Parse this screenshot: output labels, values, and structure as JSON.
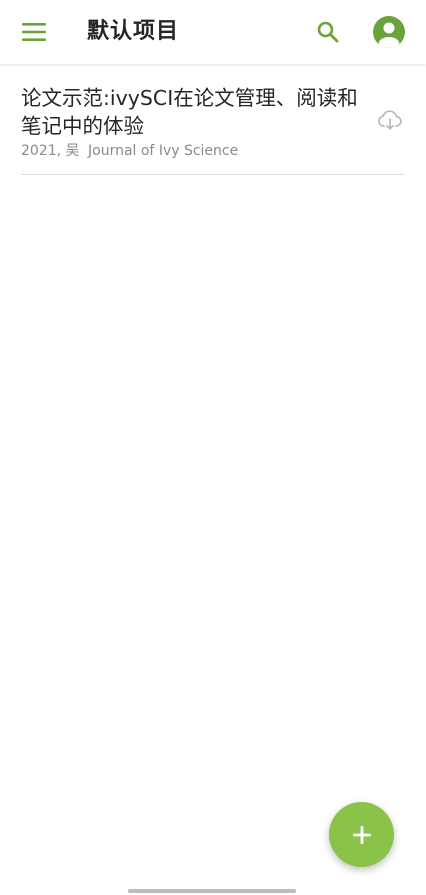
{
  "header": {
    "title": "默认项目",
    "icons": {
      "menu": "menu-icon",
      "search": "search-icon",
      "account": "account-circle-icon"
    }
  },
  "papers": [
    {
      "title": "论文示范:ivySCI在论文管理、阅读和笔记中的体验",
      "year": "2021,",
      "author": "吴",
      "journal": "Journal of Ivy Science",
      "action_icon": "cloud-download-icon"
    }
  ],
  "fab": {
    "icon": "plus-icon"
  },
  "colors": {
    "accent": "#6aa339",
    "fab": "#8bc34a",
    "text": "#262626",
    "meta": "#8a8a8a",
    "divider": "#dcdcdc"
  }
}
